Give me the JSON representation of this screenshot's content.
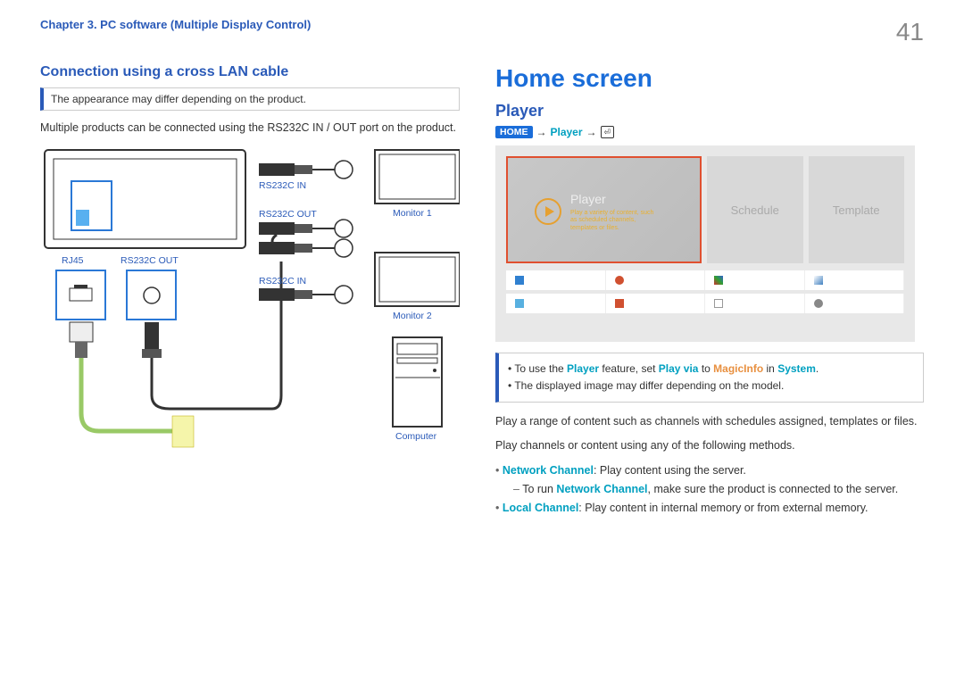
{
  "header": {
    "chapter": "Chapter 3. PC software (Multiple Display Control)",
    "page_number": "41"
  },
  "left": {
    "section_title": "Connection using a cross LAN cable",
    "note": "The appearance may differ depending on the product.",
    "body": "Multiple products can be connected using the RS232C IN / OUT port on the product.",
    "labels": {
      "rj45": "RJ45",
      "rs232c_out": "RS232C OUT",
      "rs232c_in_1": "RS232C IN",
      "rs232c_out_2": "RS232C OUT",
      "rs232c_in_2": "RS232C IN",
      "monitor1": "Monitor 1",
      "monitor2": "Monitor 2",
      "computer": "Computer"
    }
  },
  "right": {
    "h1": "Home screen",
    "h2": "Player",
    "path": {
      "home": "HOME",
      "player": "Player",
      "enter": "⏎"
    },
    "screenshot": {
      "tile_player": "Player",
      "tile_desc": "Play a variety of content, such as scheduled channels, templates or files.",
      "tile_schedule": "Schedule",
      "tile_template": "Template"
    },
    "note2_line1_pre": "To use the ",
    "note2_line1_player": "Player",
    "note2_line1_mid": " feature, set ",
    "note2_line1_playvia": "Play via",
    "note2_line1_to": " to ",
    "note2_line1_magicinfo": "MagicInfo",
    "note2_line1_in": " in ",
    "note2_line1_system": "System",
    "note2_line1_end": ".",
    "note2_line2": "The displayed image may differ depending on the model.",
    "body1": "Play a range of content such as channels with schedules assigned, templates or files.",
    "body2": "Play channels or content using any of the following methods.",
    "bullets": {
      "network_channel_label": "Network Channel",
      "network_channel_text": ": Play content using the server.",
      "network_sub_pre": "To run ",
      "network_sub_label": "Network Channel",
      "network_sub_post": ", make sure the product is connected to the server.",
      "local_channel_label": "Local Channel",
      "local_channel_text": ": Play content in internal memory or from external memory."
    }
  }
}
